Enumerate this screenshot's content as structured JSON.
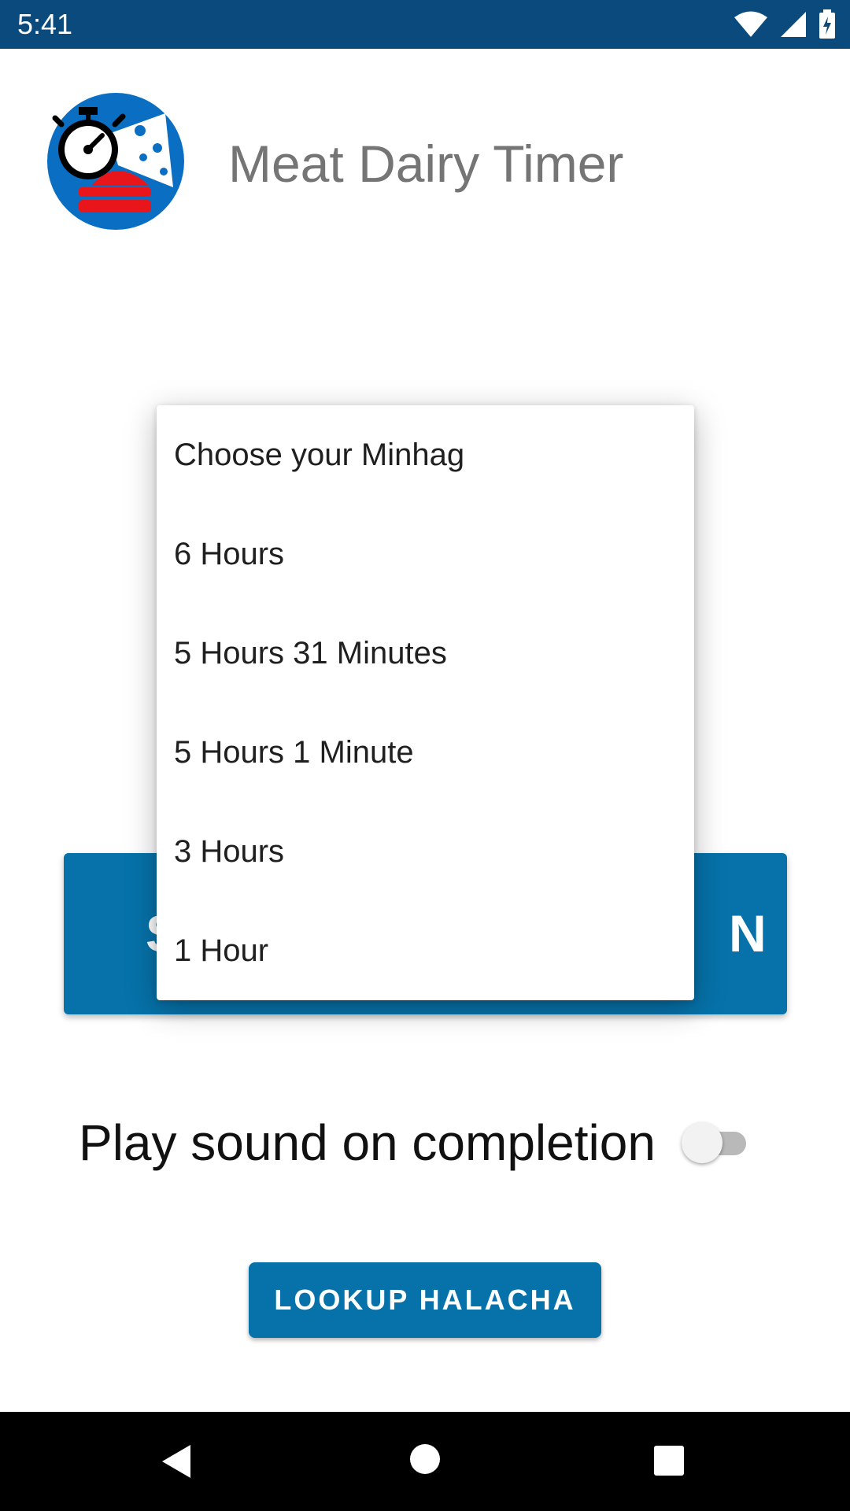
{
  "status_bar": {
    "time": "5:41",
    "icons": [
      "wifi-icon",
      "signal-icon",
      "battery-charging-icon"
    ]
  },
  "header": {
    "title": "Meat Dairy Timer",
    "logo_icon": "stopwatch-meat-cheese-logo"
  },
  "main": {
    "start_button_label": "S",
    "start_button_label_tail": "N",
    "sound_toggle": {
      "label": "Play sound on completion",
      "checked": false
    },
    "lookup_button_label": "LOOKUP HALACHA"
  },
  "dropdown": {
    "items": [
      "Choose your Minhag",
      "6 Hours",
      "5 Hours 31 Minutes",
      "5 Hours 1 Minute",
      "3 Hours",
      "1 Hour"
    ]
  },
  "nav_bar": {
    "icons": [
      "back-icon",
      "home-icon",
      "recents-icon"
    ]
  },
  "colors": {
    "status_bar": "#0b4a7c",
    "accent": "#0672a9",
    "title_text": "#757575"
  }
}
